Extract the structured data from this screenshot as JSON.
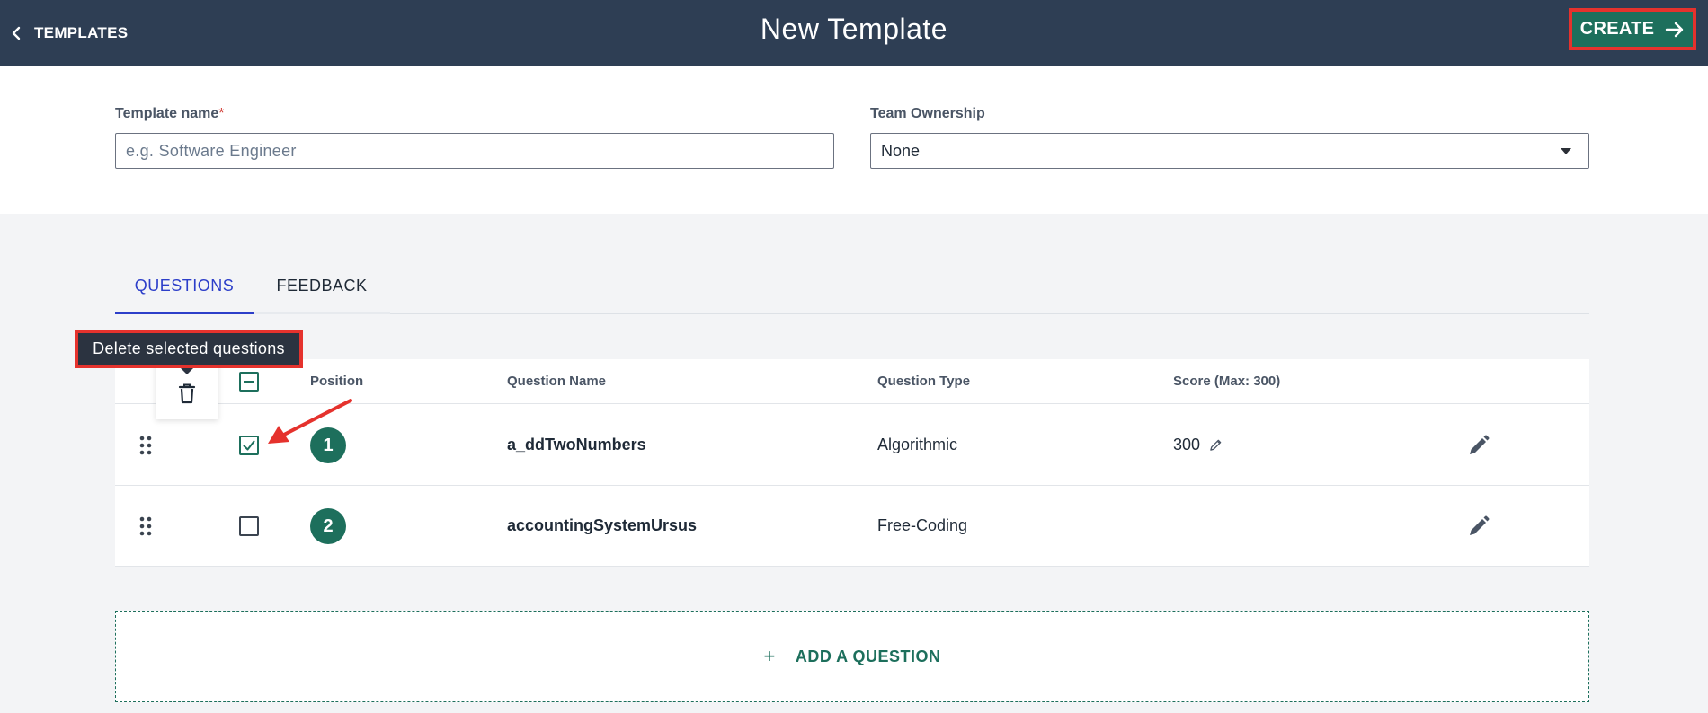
{
  "header": {
    "back_label": "TEMPLATES",
    "title": "New Template",
    "create_label": "CREATE"
  },
  "form": {
    "template_name_label": "Template name",
    "template_name_required": "*",
    "template_name_placeholder": "e.g. Software Engineer",
    "template_name_value": "",
    "team_ownership_label": "Team Ownership",
    "team_ownership_value": "None"
  },
  "tabs": [
    {
      "label": "QUESTIONS",
      "active": true
    },
    {
      "label": "FEEDBACK",
      "active": false
    }
  ],
  "tooltip": "Delete selected questions",
  "table": {
    "headers": {
      "position": "Position",
      "question_name": "Question Name",
      "question_type": "Question Type",
      "score": "Score (Max: 300)"
    },
    "rows": [
      {
        "position": "1",
        "name": "a_ddTwoNumbers",
        "type": "Algorithmic",
        "score": "300",
        "checked": true
      },
      {
        "position": "2",
        "name": "accountingSystemUrsus",
        "type": "Free-Coding",
        "score": "",
        "checked": false
      }
    ]
  },
  "add_question": {
    "plus": "+",
    "label": "ADD A QUESTION"
  },
  "icons": [
    "chevron-left-icon",
    "arrow-right-icon",
    "drag-handle-icon",
    "trash-icon",
    "pencil-icon",
    "check-icon"
  ],
  "colors": {
    "header_bg": "#2e3e54",
    "accent_green": "#1d6f5c",
    "active_tab_blue": "#2c3ec9",
    "annotation_red": "#e5322d"
  }
}
